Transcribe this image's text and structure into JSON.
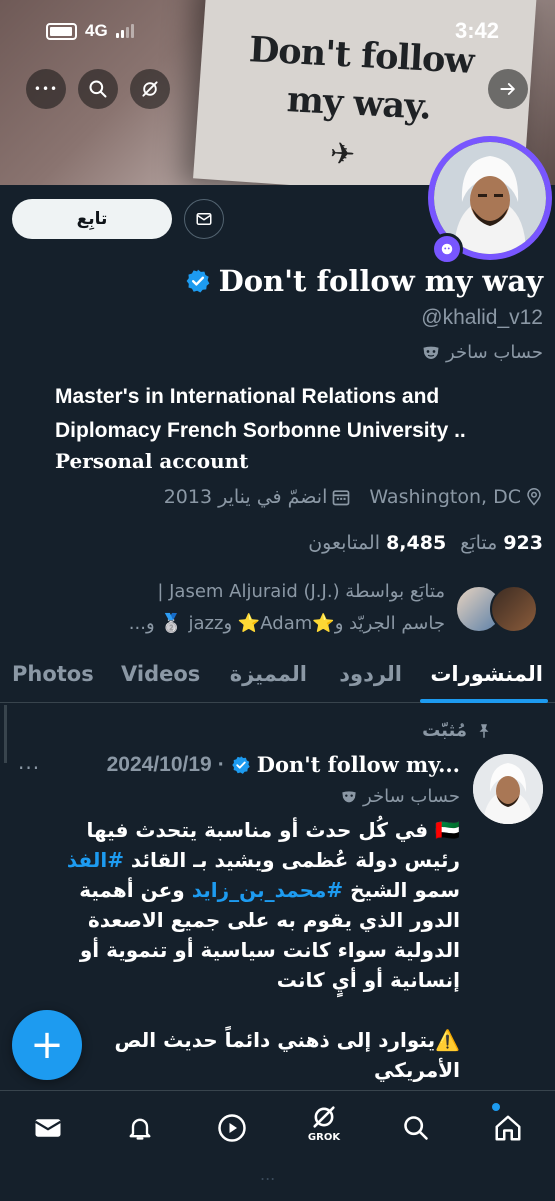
{
  "status_bar": {
    "network": "4G",
    "time": "3:42"
  },
  "banner": {
    "text_line1": "Don't follow",
    "text_line2": "my way.",
    "plane_glyph": "✈"
  },
  "actions": {
    "more_glyph": "•••",
    "follow_label": "تابِع"
  },
  "profile": {
    "display_name": "Don't follow my way",
    "handle": "@khalid_v12",
    "parody_label": "حساب ساخر",
    "bio_line1": "Master's in International Relations and",
    "bio_line2": "Diplomacy French Sorbonne University ..",
    "bio_line3": "Personal account",
    "location": "Washington, DC",
    "joined": "انضمّ في يناير 2013",
    "following_count": "923",
    "following_label": "متابَع",
    "followers_count": "8,485",
    "followers_label": "المتابعون",
    "followed_by_line1": "متابَع بواسطة (.Jasem Aljuraid (J.J | ",
    "followed_by_line2": "جاسم الجريّد و⭐Adam⭐ وjazz 🥈 و..."
  },
  "tabs": [
    {
      "label": "المنشورات",
      "active": true
    },
    {
      "label": "الردود",
      "active": false
    },
    {
      "label": "المميزة",
      "active": false
    },
    {
      "label": "Videos",
      "active": false
    },
    {
      "label": "Photos",
      "active": false
    }
  ],
  "post": {
    "pinned_label": "مُثبّت",
    "author_name": "Don't follow my...",
    "date": "2024/10/19",
    "separator": "·",
    "more_glyph": "···",
    "parody_label": "حساب ساخر",
    "line1": "🇦🇪 في كُل حدث أو مناسبة يتحدث فيها",
    "line2a": "رئيس دولة عُظمى ويشيد بـ القائد ",
    "line2b": "#الفذ",
    "line3a": "سمو الشيخ ",
    "line3b": "#محمد_بن_زايد",
    "line3c": " وعن أهمية",
    "line4": "الدور الذي يقوم به على جميع الاصعدة",
    "line5": "الدولية سواء كانت سياسية أو تنموية أو",
    "line6": "إنسانية أو أيٍ كانت",
    "line7": "⚠️يتوارد إلى ذهني دائماً حديث الص",
    "line8": "الأمريكي"
  },
  "fab": {
    "glyph": "+"
  },
  "nav": {
    "grok_label": "GROK"
  },
  "ghost_text": "..."
}
